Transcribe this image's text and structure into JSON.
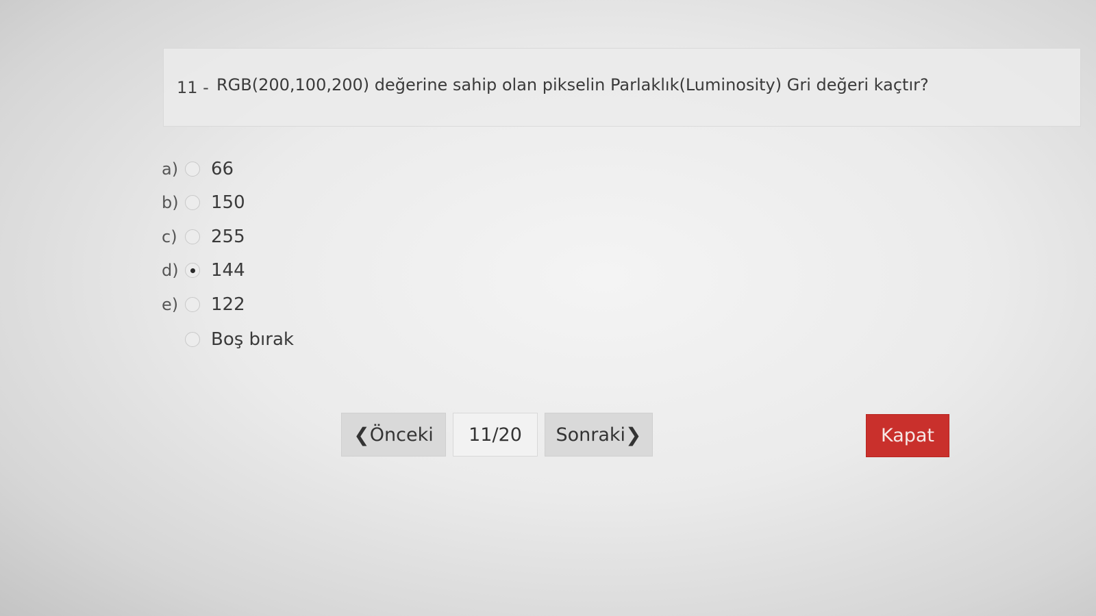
{
  "question": {
    "number": "11 -",
    "text": "RGB(200,100,200) değerine sahip olan pikselin Parlaklık(Luminosity) Gri değeri kaçtır?"
  },
  "options": [
    {
      "letter": "a)",
      "value": "66",
      "selected": false
    },
    {
      "letter": "b)",
      "value": "150",
      "selected": false
    },
    {
      "letter": "c)",
      "value": "255",
      "selected": false
    },
    {
      "letter": "d)",
      "value": "144",
      "selected": true
    },
    {
      "letter": "e)",
      "value": "122",
      "selected": false
    },
    {
      "letter": "",
      "value": "Boş bırak",
      "selected": false
    }
  ],
  "navigation": {
    "prev_label": "Önceki",
    "prev_icon": "chevron-left-icon",
    "page_indicator": "11/20",
    "next_label": "Sonraki",
    "next_icon": "chevron-right-icon",
    "close_label": "Kapat"
  },
  "colors": {
    "close_button": "#c9302c",
    "nav_button": "#d9d9d9"
  }
}
